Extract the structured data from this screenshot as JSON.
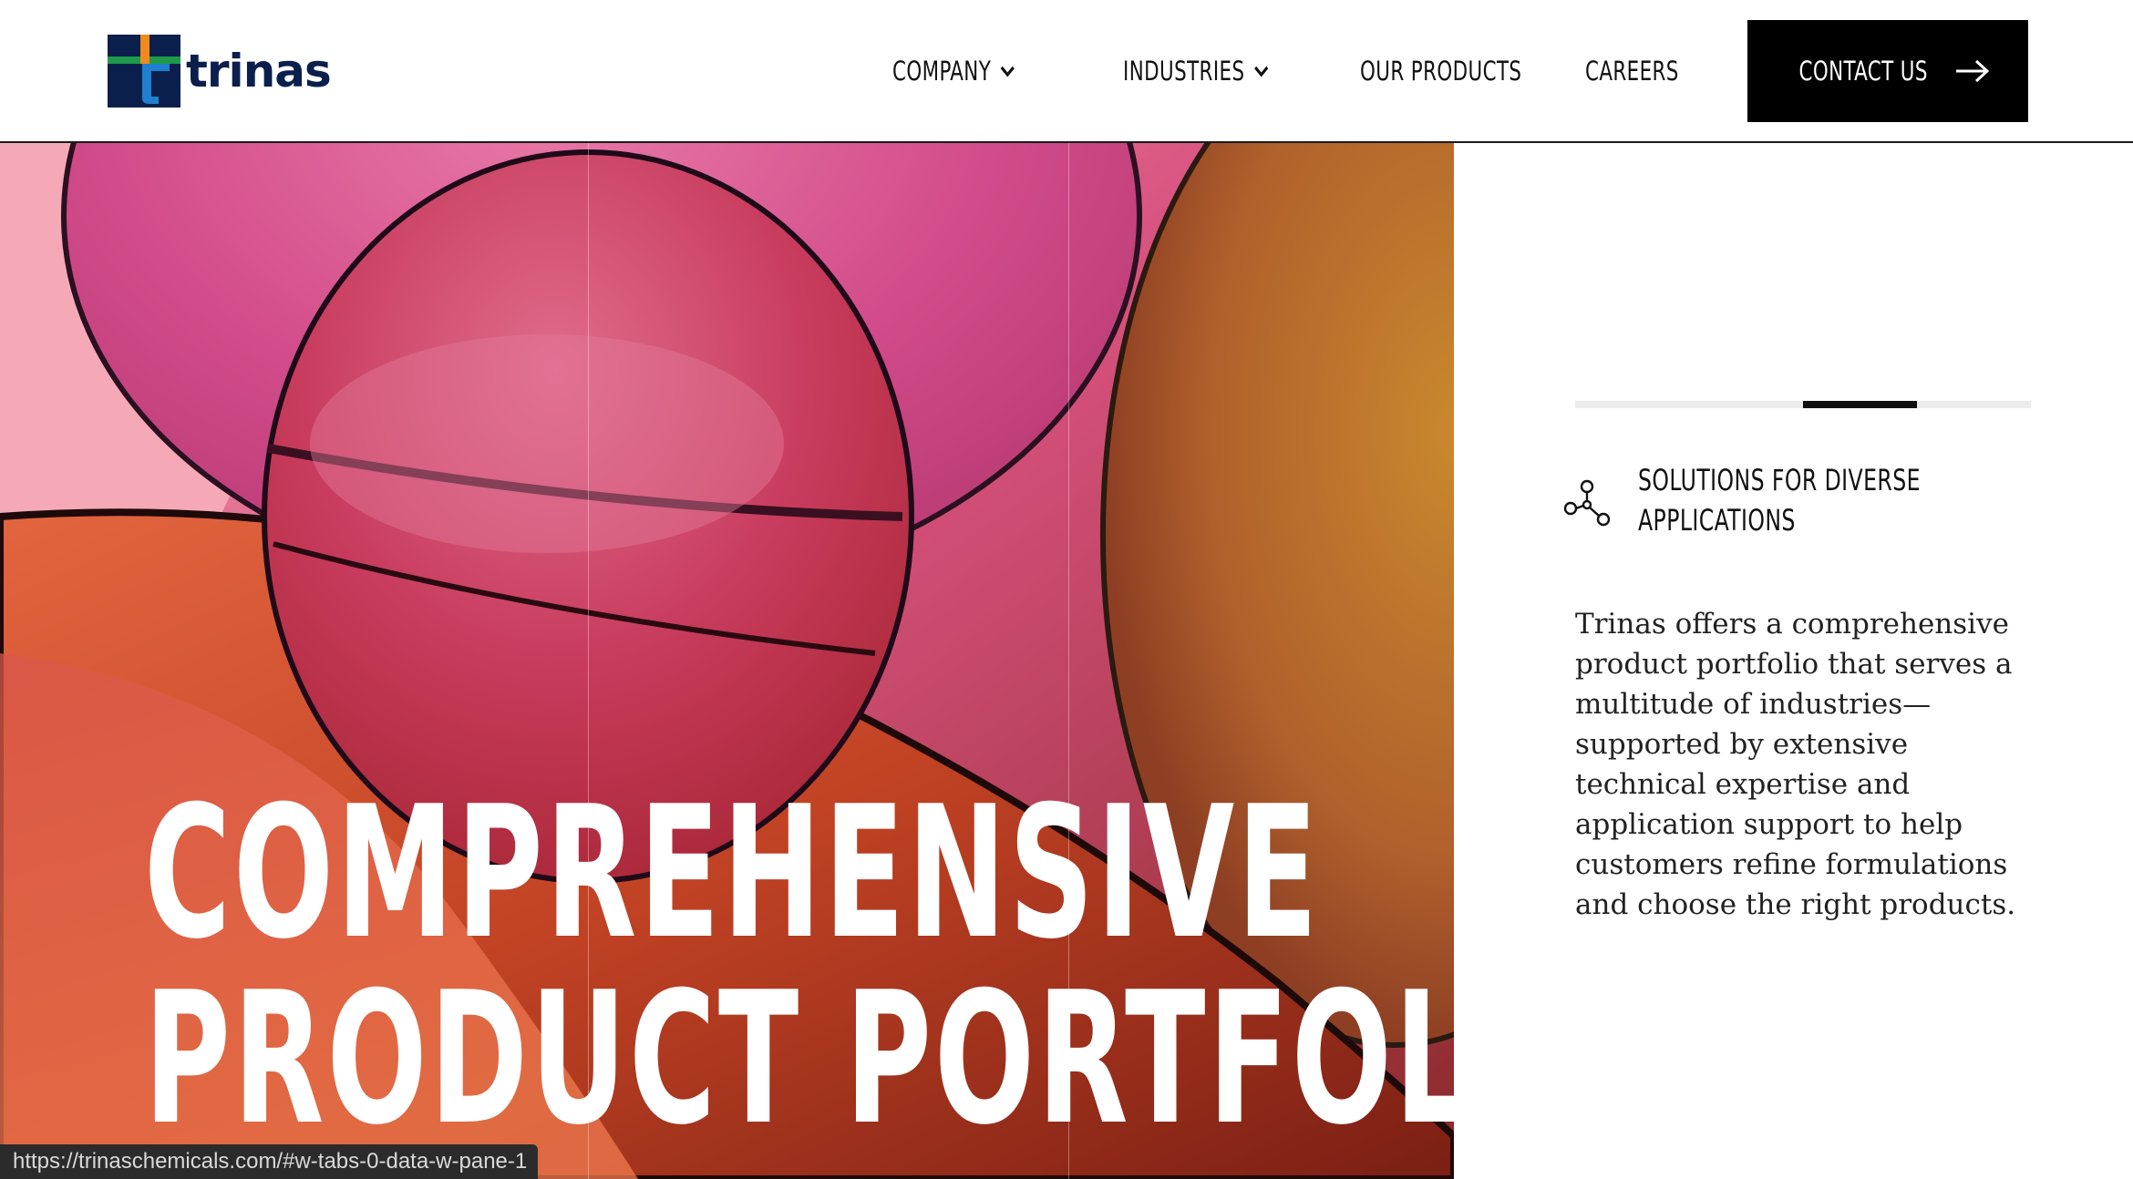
{
  "brand": {
    "name": "trinas"
  },
  "nav": {
    "items": [
      {
        "label": "COMPANY",
        "has_dropdown": true
      },
      {
        "label": "INDUSTRIES",
        "has_dropdown": true
      },
      {
        "label": "OUR PRODUCTS",
        "has_dropdown": false
      },
      {
        "label": "CAREERS",
        "has_dropdown": false
      }
    ],
    "contact_label": "CONTACT US"
  },
  "hero": {
    "title_line1": "COMPREHENSIVE",
    "title_line2": "PRODUCT PORTFOLIO"
  },
  "panel": {
    "progress": {
      "segments": 4,
      "active_index": 2
    },
    "feature_icon": "network-nodes-icon",
    "feature_title": "SOLUTIONS FOR DIVERSE APPLICATIONS",
    "description": "Trinas offers a comprehensive product portfolio that serves a multitude of industries—supported by extensive technical expertise and application support to help customers refine formulations and choose the right products."
  },
  "status_bar": {
    "url": "https://trinaschemicals.com/#w-tabs-0-data-w-pane-1"
  },
  "colors": {
    "brand_navy": "#0b1f4d",
    "brand_green": "#1e9a4a",
    "brand_orange": "#f08a1c",
    "brand_blue": "#1f7fd0",
    "button_black": "#000000"
  }
}
